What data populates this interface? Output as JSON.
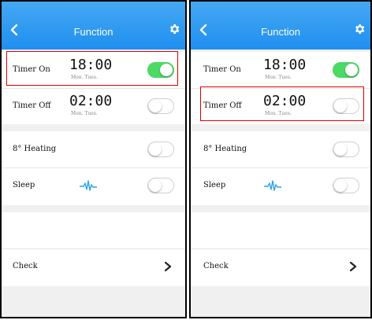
{
  "screens": [
    {
      "title": "Function",
      "timer_on": {
        "label": "Timer On",
        "time": "18:00",
        "days": "Mon. Tues.",
        "enabled": true
      },
      "timer_off": {
        "label": "Timer Off",
        "time": "02:00",
        "days": "Mon. Tues.",
        "enabled": false
      },
      "heating": {
        "label": "8° Heating",
        "enabled": false
      },
      "sleep": {
        "label": "Sleep",
        "enabled": false
      },
      "check": {
        "label": "Check"
      },
      "highlighted_row": "timer_on"
    },
    {
      "title": "Function",
      "timer_on": {
        "label": "Timer On",
        "time": "18:00",
        "days": "Mon. Tues.",
        "enabled": true
      },
      "timer_off": {
        "label": "Timer Off",
        "time": "02:00",
        "days": "Mon. Tues.",
        "enabled": false
      },
      "heating": {
        "label": "8° Heating",
        "enabled": false
      },
      "sleep": {
        "label": "Sleep",
        "enabled": false
      },
      "check": {
        "label": "Check"
      },
      "highlighted_row": "timer_off"
    }
  ],
  "colors": {
    "header": "#2196f3",
    "toggle_on": "#4cd964",
    "highlight": "#dd0000",
    "sleep_icon": "#29a3e8"
  },
  "icons": {
    "back": "chevron-left-icon",
    "settings": "gear-icon",
    "sleep": "sleep-wave-icon",
    "check": "chevron-right-icon"
  }
}
